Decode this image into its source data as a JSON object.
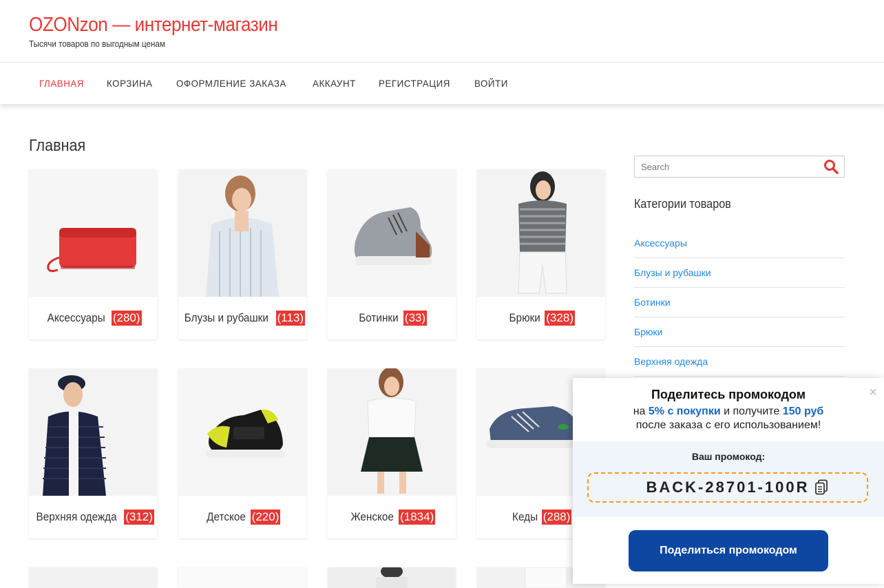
{
  "site": {
    "title": "OZONzon — интернет-магазин",
    "tagline": "Тысячи товаров по выгодным ценам"
  },
  "nav": [
    {
      "label": "ГЛАВНАЯ",
      "active": true
    },
    {
      "label": "КОРЗИНА"
    },
    {
      "label": "ОФОРМЛЕНИЕ ЗАКАЗА"
    },
    {
      "label": "АККАУНТ"
    },
    {
      "label": "РЕГИСТРАЦИЯ"
    },
    {
      "label": "ВОЙТИ"
    }
  ],
  "page_title": "Главная",
  "categories_grid": [
    {
      "name": "Аксессуары",
      "count": "(280)",
      "image": "red-wallet"
    },
    {
      "name": "Блузы и рубашки",
      "count": "(113)",
      "image": "striped-shirt-model"
    },
    {
      "name": "Ботинки",
      "count": "(33)",
      "image": "grey-boot"
    },
    {
      "name": "Брюки",
      "count": "(328)",
      "image": "white-shorts-model"
    },
    {
      "name": "Верхняя одежда",
      "count": "(312)",
      "image": "puffer-jacket-model"
    },
    {
      "name": "Детское",
      "count": "(220)",
      "image": "black-yellow-sneaker"
    },
    {
      "name": "Женское",
      "count": "(1834)",
      "image": "skirt-model"
    },
    {
      "name": "Кеды",
      "count": "(288)",
      "image": "denim-sneaker"
    }
  ],
  "sidebar": {
    "search_placeholder": "Search",
    "categories_title": "Категории товаров",
    "categories": [
      "Аксессуары",
      "Блузы и рубашки",
      "Ботинки",
      "Брюки",
      "Верхняя одежда"
    ]
  },
  "popup": {
    "heading": "Поделитесь промокодом",
    "line1_pre": "на ",
    "line1_bold1": "5% с покупки",
    "line1_mid": " и получите ",
    "line1_bold2": "150 руб",
    "line2": "после заказа с его использованием!",
    "code_label": "Ваш промокод:",
    "code": "BACK-28701-100R",
    "button": "Поделиться промокодом",
    "close": "×"
  },
  "colors": {
    "accent": "#e53935",
    "link": "#1e88e5",
    "popup_button": "#0d47a1",
    "code_border": "#f59b1a"
  }
}
